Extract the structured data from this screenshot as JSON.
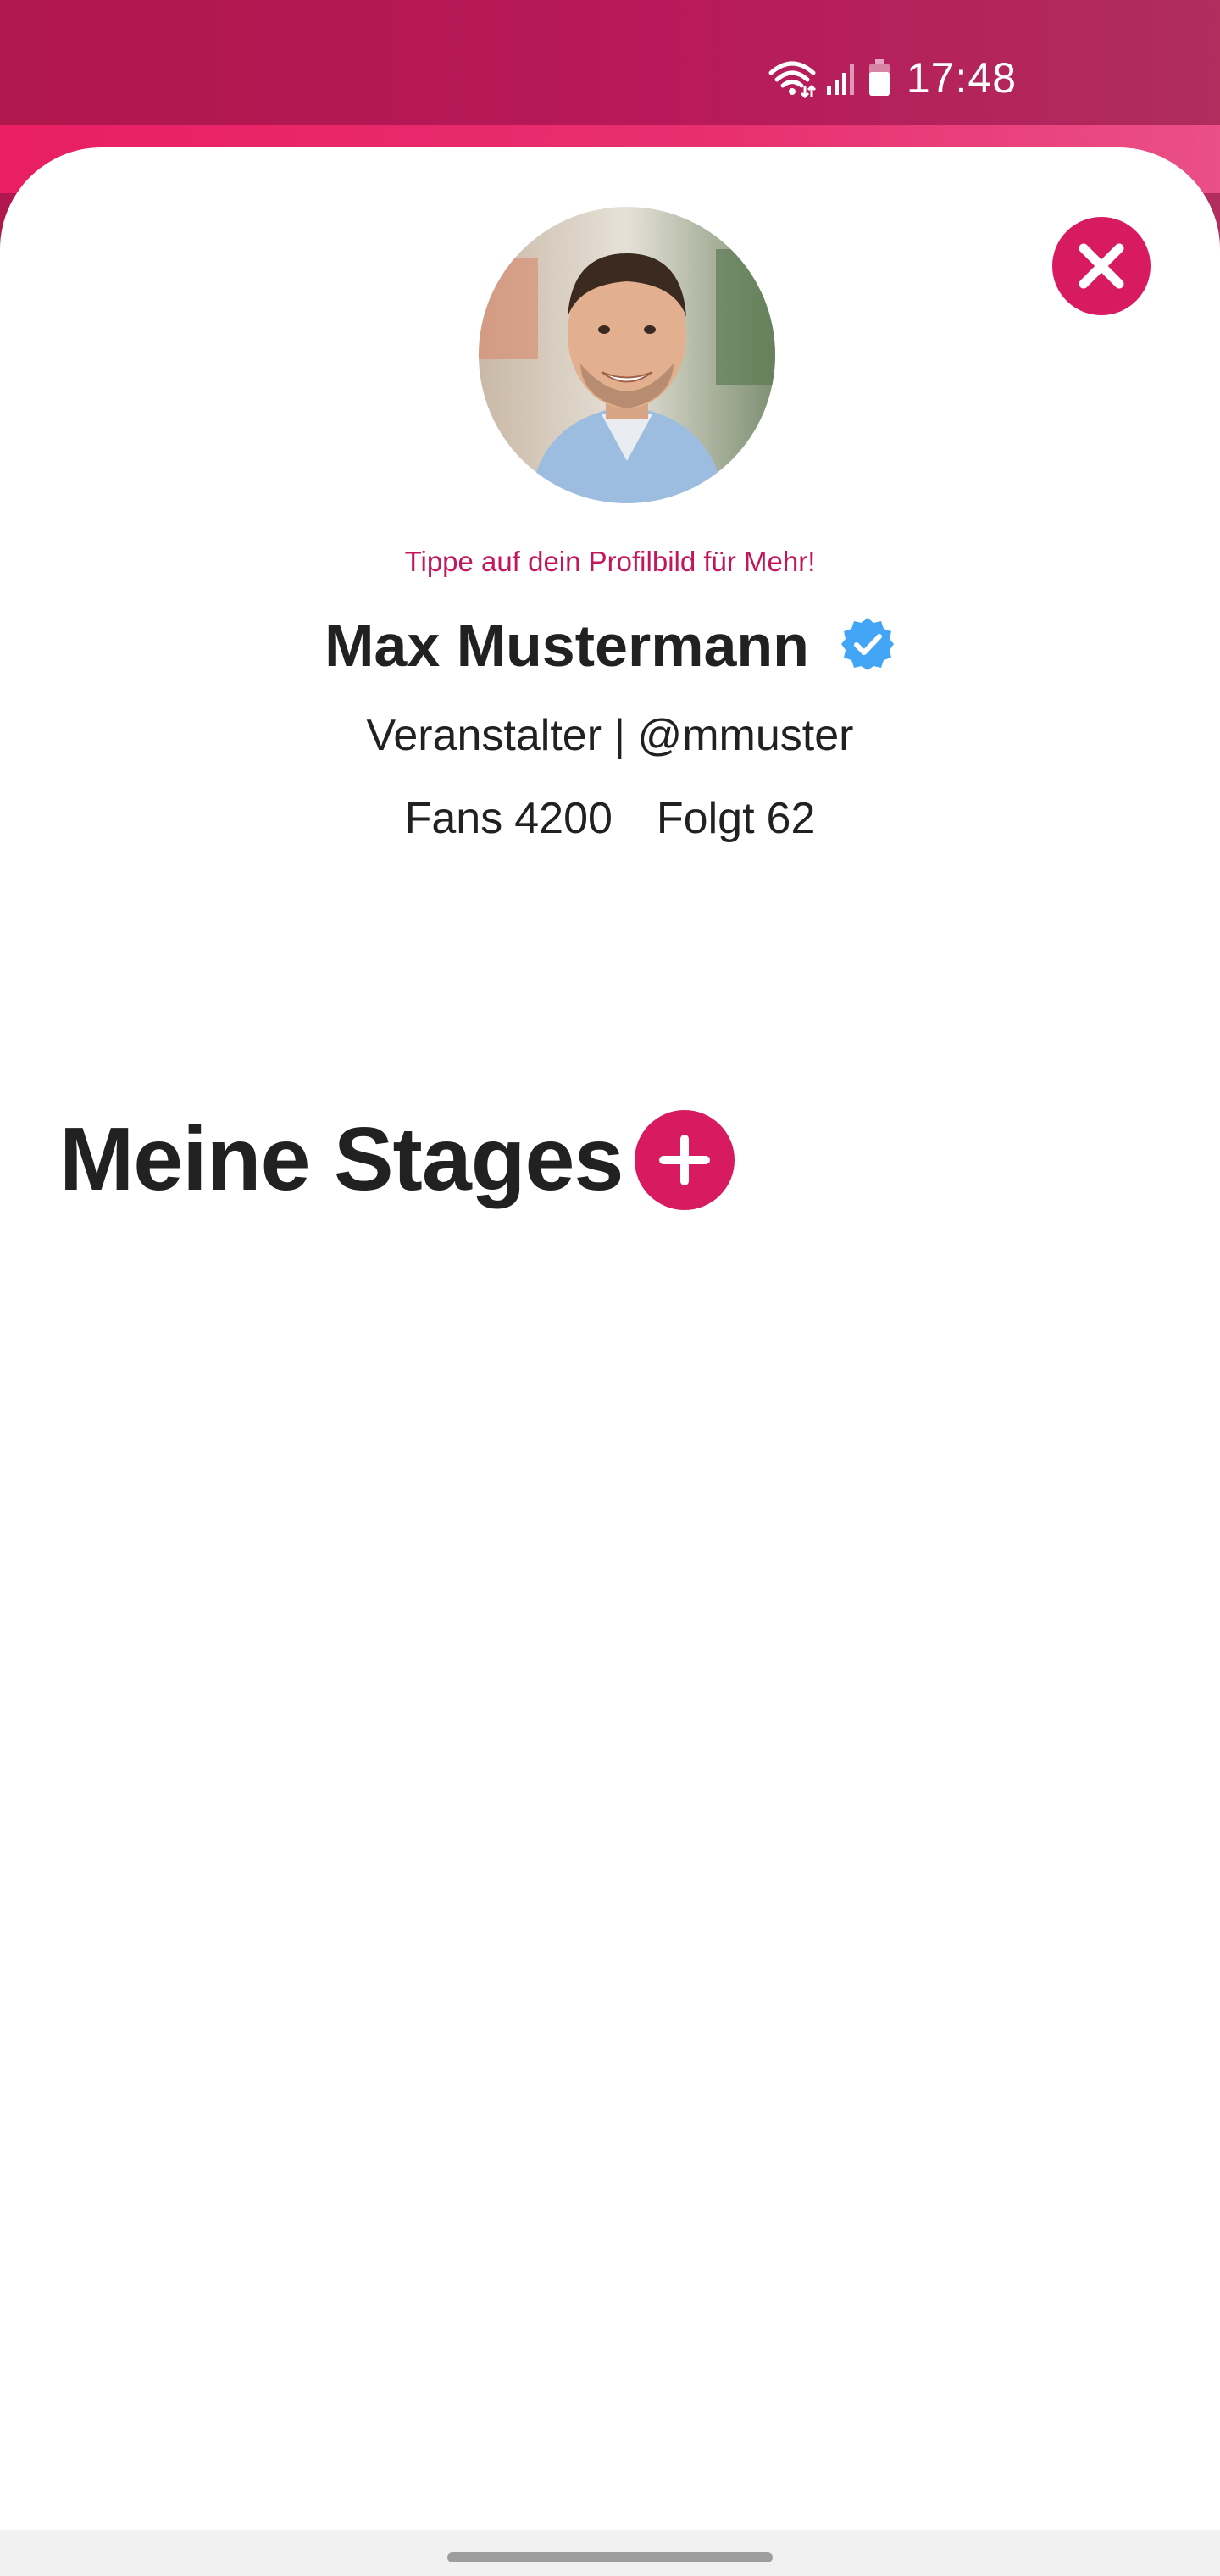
{
  "status_bar": {
    "time": "17:48",
    "icons": [
      "wifi-icon",
      "signal-icon",
      "battery-icon"
    ]
  },
  "close_icon": "close-icon",
  "profile": {
    "avatar_hint": "Tippe auf dein Profilbild für Mehr!",
    "name": "Max Mustermann",
    "verified_icon": "verified-badge-icon",
    "role_line": "Veranstalter | @mmuster",
    "fans_label": "Fans",
    "fans_count": "4200",
    "following_label": "Folgt",
    "following_count": "62"
  },
  "stages": {
    "title": "Meine Stages",
    "add_icon": "plus-icon"
  },
  "colors": {
    "status_bar": "#b0174c",
    "accent": "#d81b60",
    "hint_text": "#c2185b",
    "verified_badge": "#42a5f5",
    "text": "#212121"
  }
}
